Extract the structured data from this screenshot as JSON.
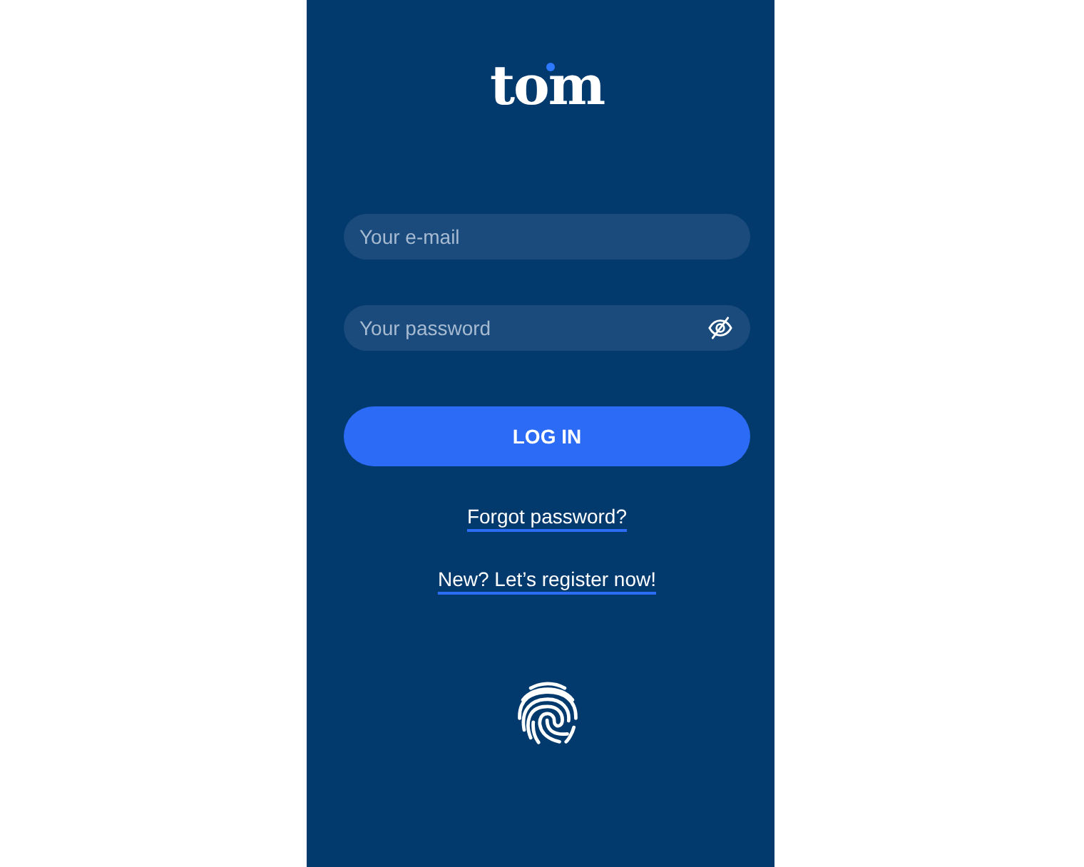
{
  "logo": {
    "text": "tom"
  },
  "fields": [
    {
      "kind": "email",
      "placeholder": "Your e-mail"
    },
    {
      "kind": "password",
      "placeholder": "Your password"
    }
  ],
  "button": {
    "label": "LOG IN"
  },
  "links": [
    "Forgot password?",
    "New? Let’s register now!"
  ]
}
